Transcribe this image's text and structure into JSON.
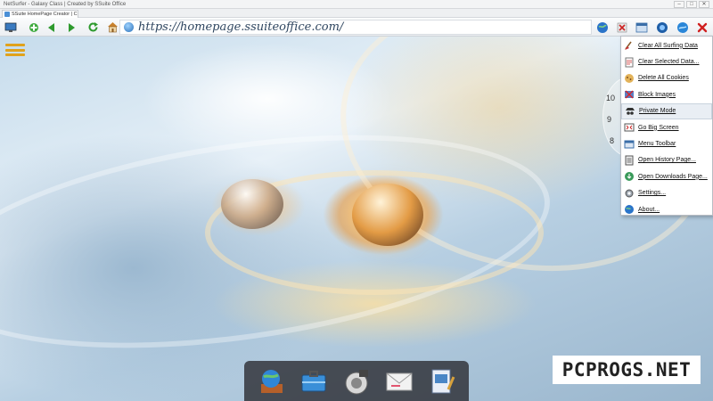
{
  "window": {
    "title": "NetSurfer - Galaxy Class | Created by SSuite Office",
    "controls": [
      "–",
      "□",
      "✕"
    ]
  },
  "tabs": [
    {
      "label": "SSuite HomePage Creator | C"
    }
  ],
  "toolbar": {
    "url": "https://homepage.ssuiteoffice.com/",
    "icons": [
      "monitor-icon",
      "add-tab-icon",
      "back-icon",
      "forward-icon",
      "reload-icon",
      "home-icon",
      "globe-icon",
      "tools-icon",
      "window-icon",
      "network-icon",
      "refresh-globe-icon",
      "close-x-icon"
    ]
  },
  "clock": {
    "numerals": [
      "10",
      "9",
      "8"
    ]
  },
  "context_menu": {
    "items": [
      {
        "label": "Clear All Surfing Data",
        "icon": "broom-icon"
      },
      {
        "label": "Clear Selected Data...",
        "icon": "document-icon"
      },
      {
        "label": "Delete All Cookies",
        "icon": "cookie-icon"
      },
      {
        "label": "Block Images",
        "icon": "image-block-icon"
      },
      {
        "label": "Private Mode",
        "icon": "incognito-icon",
        "highlighted": true
      },
      {
        "label": "Go Big Screen",
        "icon": "fullscreen-icon"
      },
      {
        "label": "Menu Toolbar",
        "icon": "menu-toolbar-icon"
      },
      {
        "label": "Open History Page...",
        "icon": "history-icon"
      },
      {
        "label": "Open Downloads Page...",
        "icon": "downloads-icon"
      },
      {
        "label": "Settings...",
        "icon": "settings-icon"
      },
      {
        "label": "About...",
        "icon": "about-globe-icon"
      }
    ]
  },
  "dock": {
    "items": [
      "globe-book-icon",
      "briefcase-icon",
      "speaker-icon",
      "mail-icon",
      "notepad-icon"
    ]
  },
  "watermark": {
    "text": "PCPROGS.NET"
  },
  "colors": {
    "menu_accent": "#e0a21c",
    "url_text": "#2f4660",
    "dock_bg": "#28282d"
  }
}
